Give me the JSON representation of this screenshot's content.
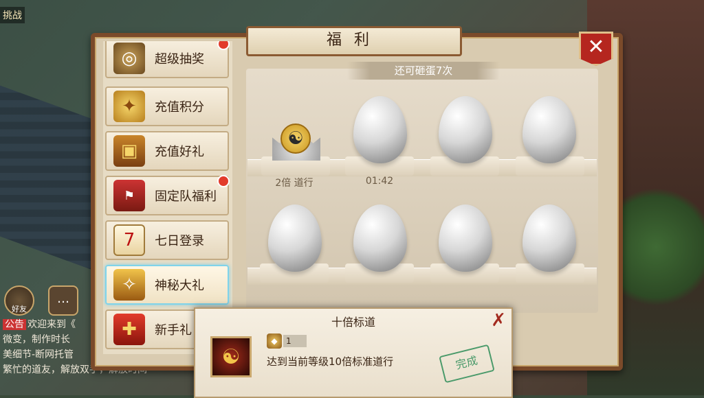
{
  "hud": {
    "top_left_link": "挑战",
    "friend_label": "好友"
  },
  "chat": {
    "tag": "公告",
    "lines": [
      "欢迎来到《",
      "微变，制作时长",
      "美细节-断网托管",
      "繁忙的道友，解放双手，解放时间"
    ]
  },
  "panel": {
    "title": "福利",
    "close_icon": "close-icon"
  },
  "sidebar": {
    "items": [
      {
        "label": "超级抽奖",
        "icon": "lottery-wheel-icon",
        "badge": true
      },
      {
        "label": "充值积分",
        "icon": "treasure-gold-icon",
        "badge": false
      },
      {
        "label": "充值好礼",
        "icon": "treasure-chest-icon",
        "badge": false
      },
      {
        "label": "固定队福利",
        "icon": "team-flag-icon",
        "badge": true
      },
      {
        "label": "七日登录",
        "icon": "calendar-scroll-icon",
        "day_number": "7",
        "badge": false
      },
      {
        "label": "神秘大礼",
        "icon": "mystery-chest-icon",
        "badge": false,
        "active": true
      },
      {
        "label": "新手礼",
        "icon": "gift-box-icon",
        "badge": false
      }
    ]
  },
  "eggs": {
    "remaining_text": "还可砸蛋7次",
    "slots": [
      {
        "state": "opened",
        "caption": "2倍 道行"
      },
      {
        "state": "egg",
        "caption": "01:42"
      },
      {
        "state": "egg",
        "caption": ""
      },
      {
        "state": "egg",
        "caption": ""
      },
      {
        "state": "egg",
        "caption": ""
      },
      {
        "state": "egg",
        "caption": ""
      },
      {
        "state": "egg",
        "caption": ""
      },
      {
        "state": "egg",
        "caption": ""
      }
    ]
  },
  "popup": {
    "title": "十倍标道",
    "reward_count": "1",
    "description": "达到当前等级10倍标准道行",
    "stamp": "完成"
  },
  "colors": {
    "panel_border": "#7b4a2a",
    "close_red": "#b5261f",
    "active_glow": "#7fd3ea",
    "badge_red": "#e23b2b"
  }
}
